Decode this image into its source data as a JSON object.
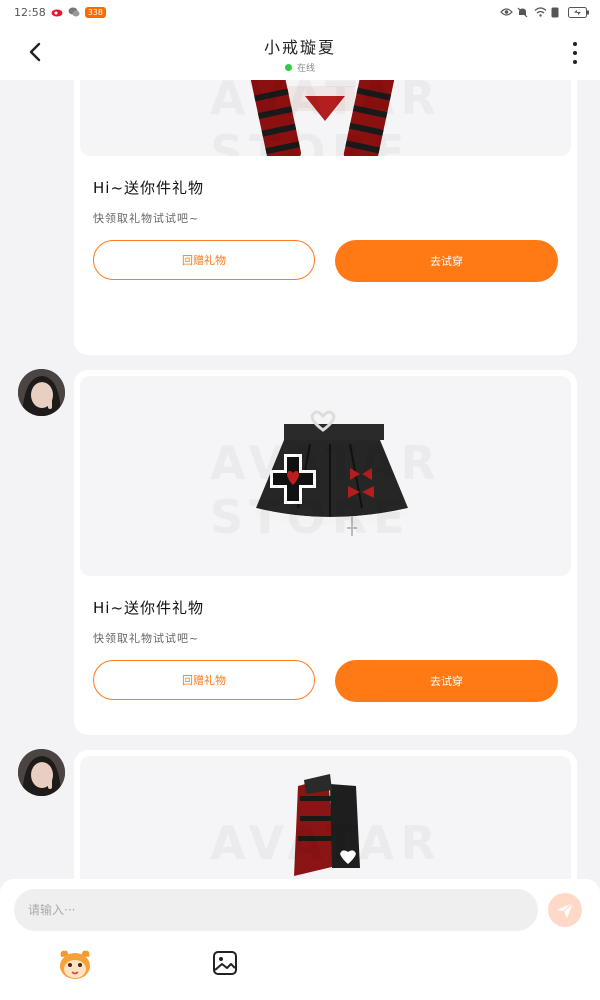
{
  "status_bar": {
    "time": "12:58",
    "badge": "338"
  },
  "header": {
    "title": "小戒璇夏",
    "status": "在线"
  },
  "messages": [
    {
      "title": "Hi~送你件礼物",
      "subtitle": "快领取礼物试试吧~",
      "return_gift_label": "回赠礼物",
      "try_on_label": "去试穿",
      "item": "top",
      "watermark": "AVATAR STORE"
    },
    {
      "title": "Hi~送你件礼物",
      "subtitle": "快领取礼物试试吧~",
      "return_gift_label": "回赠礼物",
      "try_on_label": "去试穿",
      "item": "skirt",
      "watermark": "AVATAR STORE"
    },
    {
      "item": "boots",
      "watermark": "AVATAR STORE"
    }
  ],
  "input_bar": {
    "placeholder": "请输入···"
  },
  "colors": {
    "accent": "#ff7a14",
    "online": "#2ecc40",
    "background": "#f3f3f5"
  },
  "icons": [
    "back-arrow-icon",
    "more-vertical-icon",
    "send-icon",
    "mascot-icon",
    "image-icon"
  ]
}
